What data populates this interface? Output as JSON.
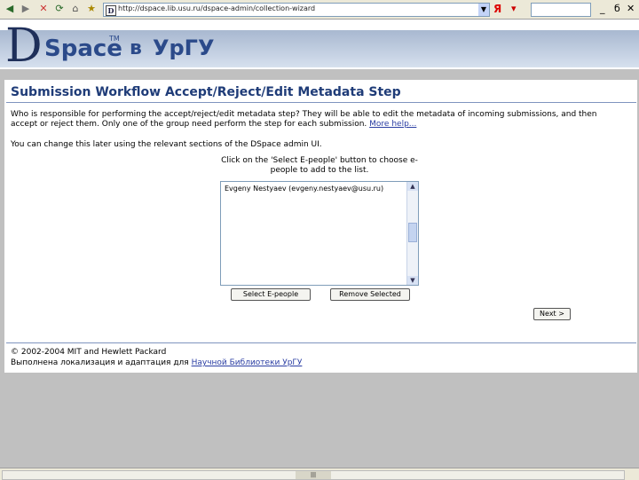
{
  "browser": {
    "url": "http://dspace.lib.usu.ru/dspace-admin/collection-wizard",
    "window_min": "_",
    "window_restore": "б",
    "window_close": "✕",
    "yandex_logo": "Я"
  },
  "banner": {
    "logo_letter": "D",
    "logo_word": "Space",
    "logo_tm": "TM",
    "logo_prep": "в",
    "logo_org": "УрГУ"
  },
  "page": {
    "title": "Submission Workflow Accept/Reject/Edit Metadata Step",
    "intro_part1": "Who is responsible for performing the accept/reject/edit metadata step? They will be able to edit the metadata of incoming submissions, and then accept or reject them. Only one of the group need perform the step for each submission.",
    "more_help": "More help...",
    "change_later": "You can change this later using the relevant sections of the DSpace admin UI.",
    "instruction": "Click on the 'Select E-people' button to choose e-people to add to the list.",
    "list_items": [
      "Evgeny Nestyaev (evgeny.nestyaev@usu.ru)"
    ],
    "select_button": "Select E-people",
    "remove_button": "Remove Selected",
    "next_button": "Next >"
  },
  "footer": {
    "copyright": "© 2002-2004 MIT and Hewlett Packard",
    "localized_prefix": "Выполнена локализация и адаптация для",
    "localized_link": "Научной Библиотеки УрГУ"
  }
}
